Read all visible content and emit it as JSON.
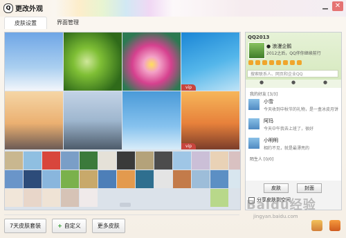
{
  "window": {
    "title": "更改外观"
  },
  "tabs": [
    {
      "label": "皮肤设置"
    },
    {
      "label": "界面管理"
    }
  ],
  "skins": {
    "vip_badge": "vip"
  },
  "buttons": {
    "seven_day": "7天皮肤套装",
    "custom": "自定义",
    "more": "更多皮肤"
  },
  "preview": {
    "qq_label": "QQ2013",
    "status_text": "● 浪漫企鹅",
    "motto": "2012之后，QQ伴你继续前行",
    "search_placeholder": "搜索联系人、网页和企业QQ",
    "group_friends": "我的好友 [3/3]",
    "group_strangers": "陌生人 [0/0]",
    "contacts": [
      {
        "name": "小雪",
        "desc": "今天收到中秋节的礼物，是一盒冰皮月饼"
      },
      {
        "name": "阿玛",
        "desc": "今天中午我去上班了，很好"
      },
      {
        "name": "小明明",
        "desc": "相约不见，就是最漂亮的"
      }
    ],
    "btn_skin": "皮肤",
    "btn_cover": "封面",
    "checkbox_label": "分享皮肤到空间"
  },
  "watermark": {
    "brand": "Baidu经验",
    "url": "jingyan.baidu.com"
  }
}
